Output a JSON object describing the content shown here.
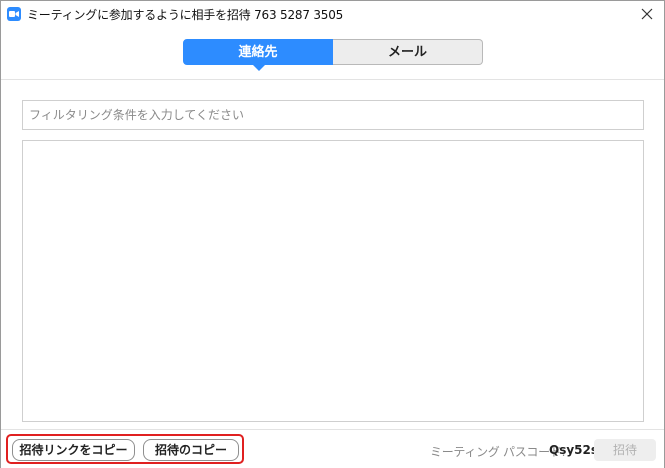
{
  "window": {
    "title": "ミーティングに参加するように相手を招待 763 5287 3505"
  },
  "tabs": [
    {
      "label": "連絡先",
      "selected": true
    },
    {
      "label": "メール",
      "selected": false
    }
  ],
  "filter": {
    "placeholder": "フィルタリング条件を入力してください",
    "value": ""
  },
  "contacts": [],
  "footer": {
    "copy_link_label": "招待リンクをコピー",
    "copy_invite_label": "招待のコピー",
    "passcode_label": "ミーティング パスコード:",
    "passcode_value": "Qsy52s",
    "invite_label": "招待"
  },
  "colors": {
    "accent": "#2d8cff",
    "highlight": "#e02020"
  },
  "icons": {
    "app": "zoom-camera-icon",
    "close": "close-icon"
  }
}
